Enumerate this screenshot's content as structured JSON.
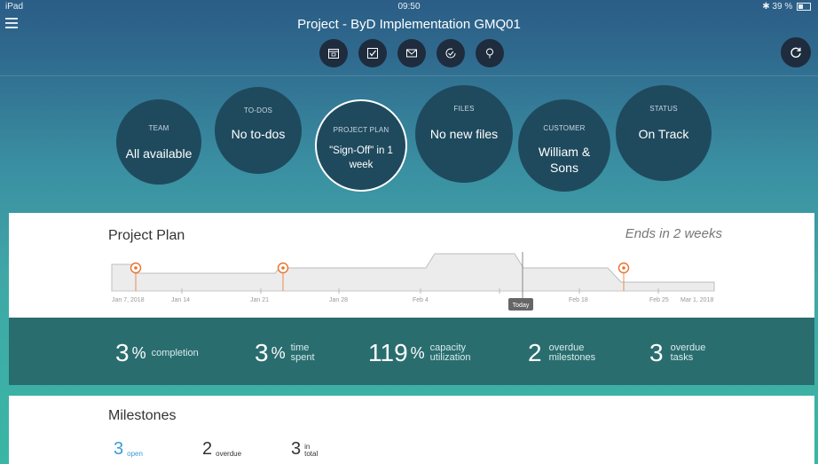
{
  "status_bar": {
    "device": "iPad",
    "time": "09:50",
    "battery": "39 %"
  },
  "header": {
    "title": "Project - ByD Implementation GMQ01"
  },
  "toolbar": {
    "icons": [
      "calendar-icon",
      "checkbox-icon",
      "mail-icon",
      "check-circle-icon",
      "lightbulb-icon"
    ],
    "refresh_icon": "refresh-icon"
  },
  "circles": [
    {
      "label": "TEAM",
      "value": "All available"
    },
    {
      "label": "TO-DOS",
      "value": "No to-dos"
    },
    {
      "label": "PROJECT PLAN",
      "value": "\"Sign-Off\" in 1 week"
    },
    {
      "label": "FILES",
      "value": "No new files"
    },
    {
      "label": "CUSTOMER",
      "value": "William & Sons"
    },
    {
      "label": "STATUS",
      "value": "On Track"
    }
  ],
  "project_plan": {
    "title": "Project Plan",
    "ends": "Ends in 2 weeks",
    "axis_labels": [
      "Jan 7, 2018",
      "Jan 14",
      "Jan 21",
      "Jan 28",
      "Feb 4",
      "Feb 18",
      "Feb 25",
      "Mar 1, 2018"
    ],
    "today_label": "Today"
  },
  "stats": [
    {
      "value": "3",
      "unit": "%",
      "label1": "completion",
      "label2": ""
    },
    {
      "value": "3",
      "unit": "%",
      "label1": "time",
      "label2": "spent"
    },
    {
      "value": "119",
      "unit": "%",
      "label1": "capacity",
      "label2": "utilization"
    },
    {
      "value": "2",
      "unit": "",
      "label1": "overdue",
      "label2": "milestones"
    },
    {
      "value": "3",
      "unit": "",
      "label1": "overdue",
      "label2": "tasks"
    }
  ],
  "milestones": {
    "title": "Milestones",
    "items": [
      {
        "value": "3",
        "label1": "open",
        "label2": "",
        "color": "#3a9ad9"
      },
      {
        "value": "2",
        "label1": "overdue",
        "label2": "",
        "color": "#333333"
      },
      {
        "value": "3",
        "label1": "in",
        "label2": "total",
        "color": "#333333"
      }
    ]
  },
  "colors": {
    "accent_orange": "#e8732e",
    "open_blue": "#3a9ad9",
    "stats_band": "#2a6d6f",
    "circle_bg": "#1f4a5e"
  }
}
